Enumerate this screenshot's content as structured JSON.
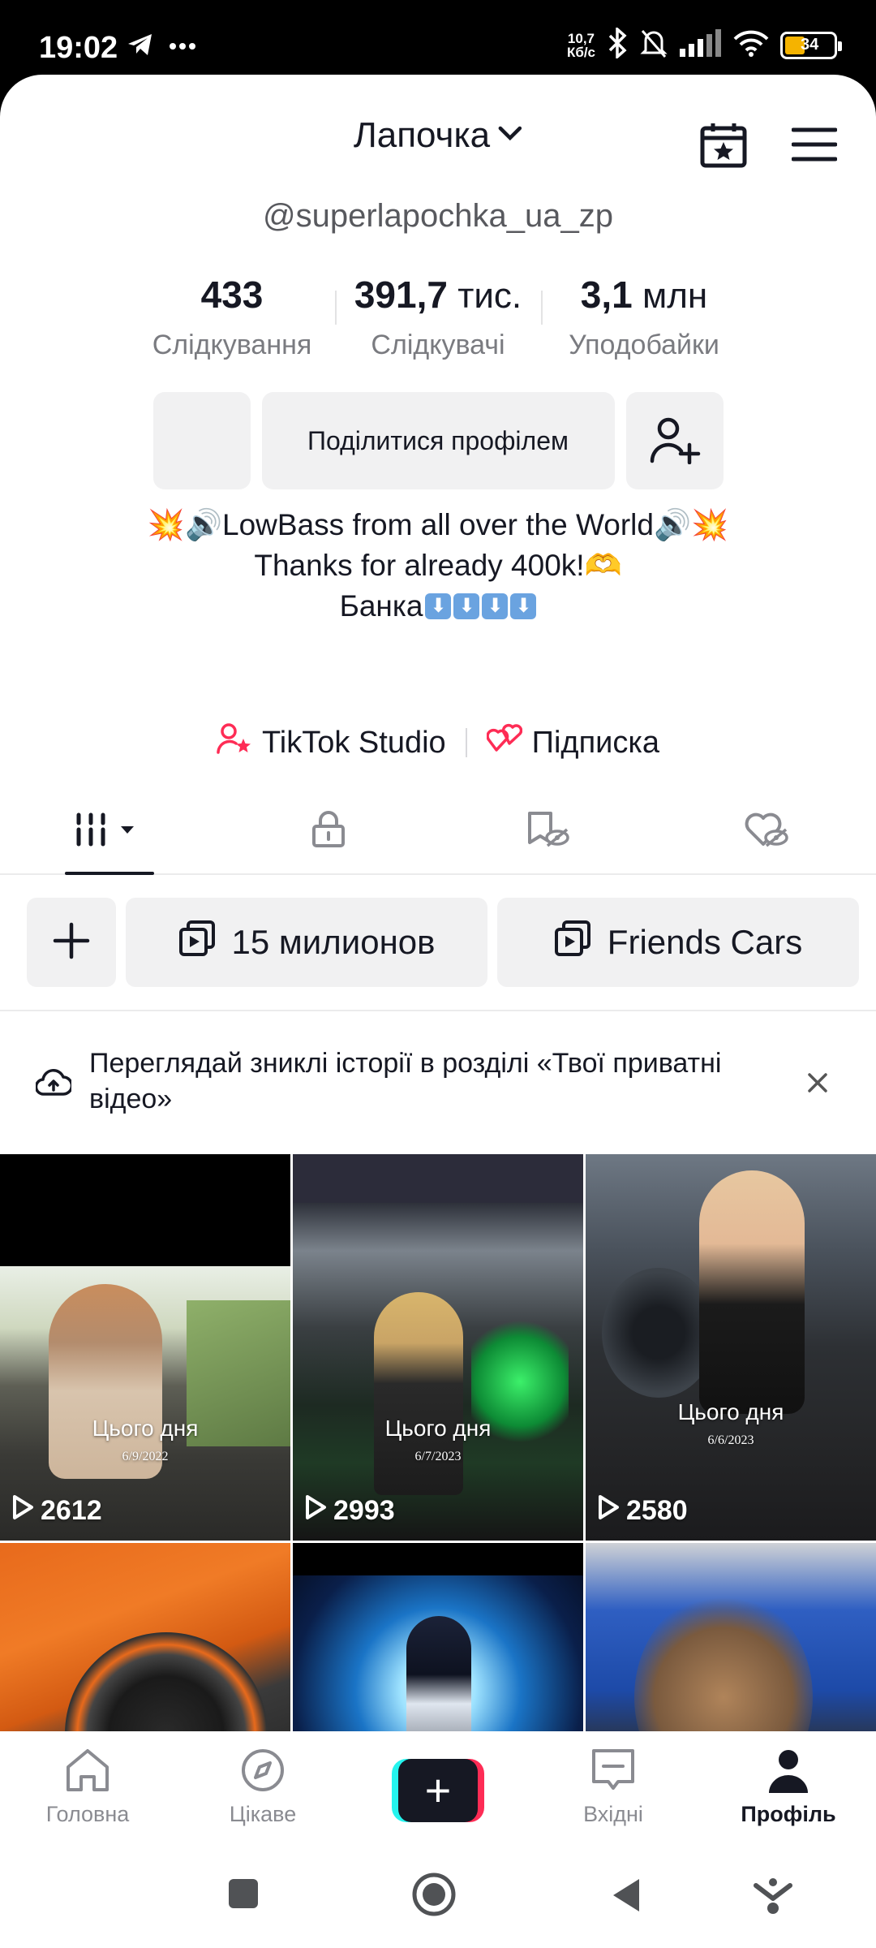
{
  "status_bar": {
    "time": "19:02",
    "net_speed_value": "10,7",
    "net_speed_unit": "Кб/с",
    "battery": "34",
    "battery_color": "#f5b300",
    "left_icons": [
      "telegram-icon",
      "more-dots-icon"
    ],
    "right_icons": [
      "bluetooth-icon",
      "bell-off-icon",
      "signal-icon",
      "wifi-icon",
      "battery-icon"
    ]
  },
  "header": {
    "profile_name": "Лапочка",
    "icons": [
      "chevron-down-icon",
      "calendar-star-icon",
      "menu-icon"
    ]
  },
  "profile": {
    "username": "@superlapochka_ua_zp",
    "stats": [
      {
        "number": "433",
        "unit": "",
        "label": "Слідкування"
      },
      {
        "number": "391,7",
        "unit": " тис.",
        "label": "Слідкувачі"
      },
      {
        "number": "3,1",
        "unit": " млн",
        "label": "Уподобайки"
      }
    ],
    "share_button": "Поділитися профілем",
    "bio": [
      "💥🔊LowBass from all over the World🔊💥",
      "Thanks for already 400k!🫶",
      "Банка"
    ],
    "bio_arrow_count": 4,
    "links": [
      {
        "label": "TikTok Studio",
        "icon": "person-star-icon"
      },
      {
        "label": "Підписка",
        "icon": "hearts-icon"
      }
    ]
  },
  "tabs": [
    {
      "icon": "videos-grid-icon",
      "active": true
    },
    {
      "icon": "lock-icon",
      "active": false
    },
    {
      "icon": "saved-icon",
      "active": false
    },
    {
      "icon": "liked-hidden-icon",
      "active": false
    }
  ],
  "playlists": [
    {
      "label": "15 милионов"
    },
    {
      "label": "Friends Cars"
    }
  ],
  "banner": {
    "text": "Переглядай зниклі історії в розділі «Твої приватні відео»"
  },
  "videos": [
    {
      "caption": "Цього дня",
      "date": "6/9/2022",
      "views": "2612"
    },
    {
      "caption": "Цього дня",
      "date": "6/7/2023",
      "views": "2993"
    },
    {
      "caption": "Цього дня",
      "date": "6/6/2023",
      "views": "2580"
    },
    {
      "caption": "",
      "date": "",
      "views": ""
    },
    {
      "caption": "",
      "date": "",
      "views": ""
    },
    {
      "caption": "",
      "date": "",
      "views": ""
    }
  ],
  "bottom_nav": [
    {
      "label": "Головна",
      "icon": "home-icon"
    },
    {
      "label": "Цікаве",
      "icon": "compass-icon"
    },
    {
      "label": "",
      "icon": "create-plus-icon"
    },
    {
      "label": "Вхідні",
      "icon": "inbox-icon"
    },
    {
      "label": "Профіль",
      "icon": "profile-icon",
      "active": true
    }
  ],
  "colors": {
    "accent": "#fe2c55",
    "cyan": "#25f4ee",
    "text": "#161823",
    "muted": "#7a7b80"
  }
}
